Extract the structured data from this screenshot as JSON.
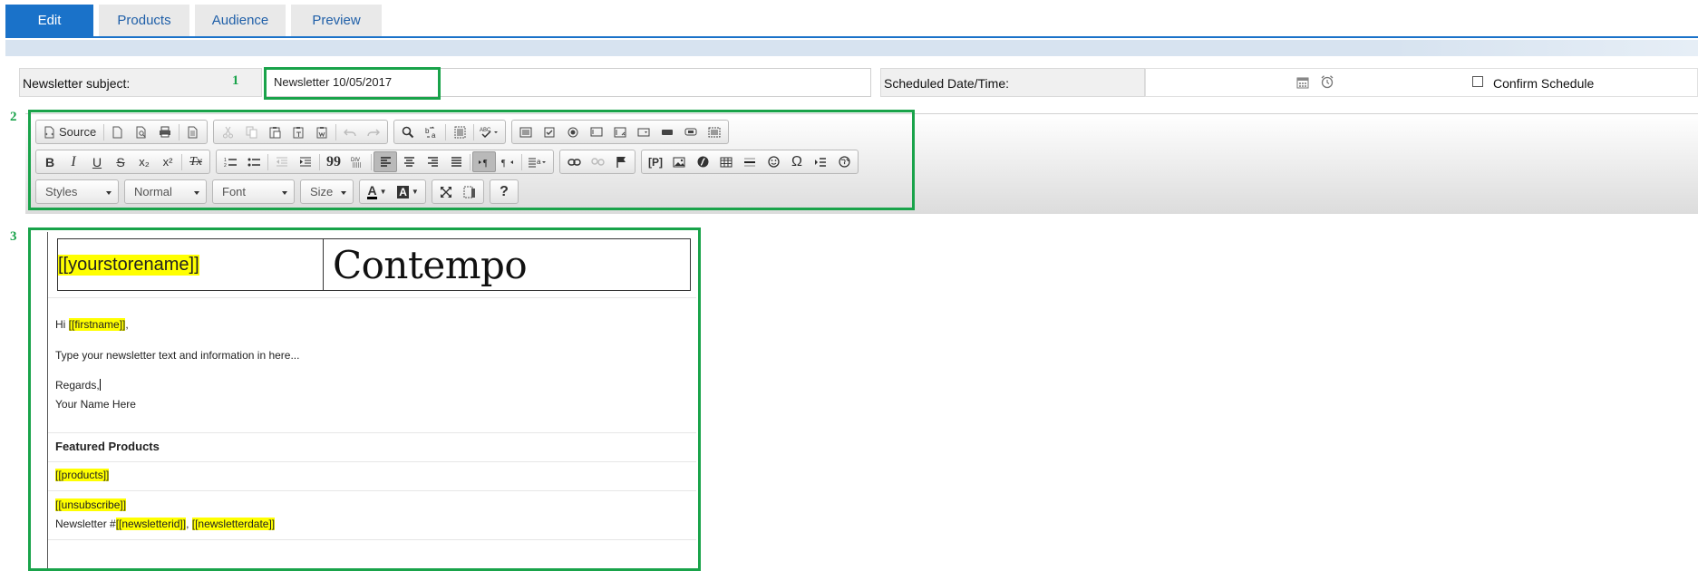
{
  "tabs": [
    {
      "label": "Edit",
      "active": true
    },
    {
      "label": "Products",
      "active": false
    },
    {
      "label": "Audience",
      "active": false
    },
    {
      "label": "Preview",
      "active": false
    }
  ],
  "subject": {
    "label": "Newsletter subject:",
    "value": "Newsletter 10/05/2017"
  },
  "schedule": {
    "label": "Scheduled Date/Time:",
    "value": "",
    "confirm_label": "Confirm Schedule",
    "confirm_checked": false
  },
  "markers": [
    "1",
    "2",
    "3"
  ],
  "toolbar": {
    "source_label": "Source",
    "styles_label": "Styles",
    "format_label": "Normal",
    "font_label": "Font",
    "size_label": "Size",
    "bold": "B",
    "italic": "I",
    "underline": "U",
    "strike": "S",
    "subscript": "x₂",
    "superscript": "x²",
    "removeformat": "Tx",
    "blockquote": "99",
    "text_color": "A",
    "bg_color": "A",
    "help": "?",
    "omega": "Ω",
    "placeholder_p": "[P]"
  },
  "content": {
    "store_placeholder": "[[yourstorename]]",
    "brand": "Contempo",
    "greeting_prefix": "Hi ",
    "firstname": "[[firstname]]",
    "greeting_suffix": ",",
    "body_text": "Type your newsletter text and information in here...",
    "regards": "Regards,",
    "signature": "Your Name Here",
    "featured_heading": "Featured Products",
    "products_placeholder": "[[products]]",
    "unsubscribe_placeholder": "[[unsubscribe]]",
    "newsletter_prefix": "Newsletter #",
    "newsletter_id": "[[newsletterid]]",
    "comma": ", ",
    "newsletter_date": "[[newsletterdate]]"
  },
  "colors": {
    "accent": "#1a72c9",
    "annotation": "#19a34a",
    "highlight": "#ffff00"
  }
}
